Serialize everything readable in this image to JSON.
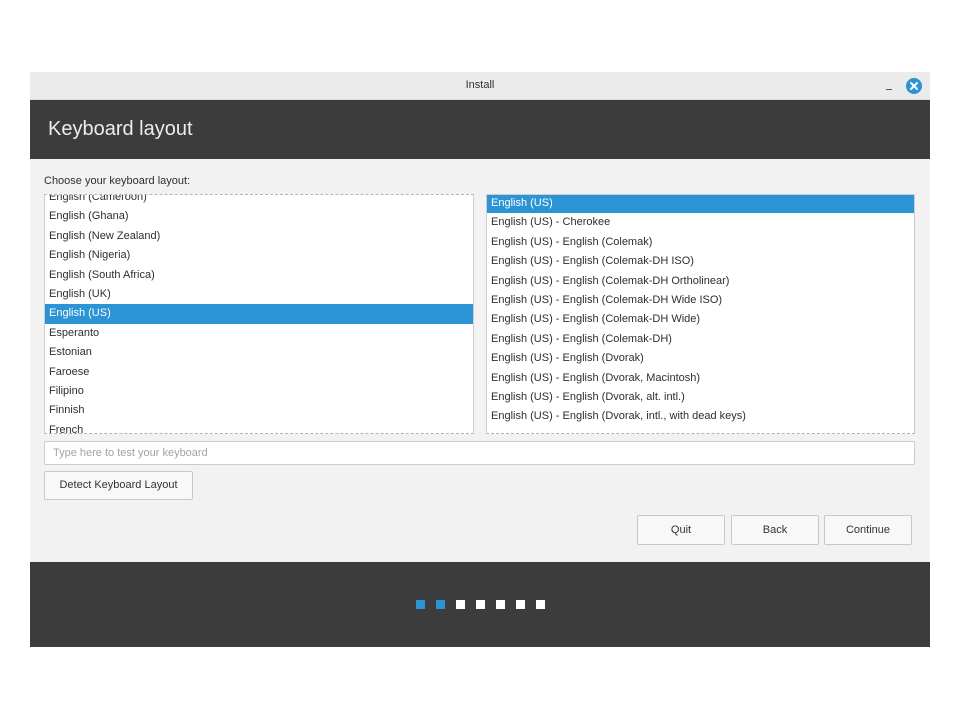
{
  "window": {
    "title": "Install"
  },
  "header": {
    "title": "Keyboard layout"
  },
  "prompt": "Choose your keyboard layout:",
  "layouts": {
    "items": [
      "English (Cameroon)",
      "English (Ghana)",
      "English (New Zealand)",
      "English (Nigeria)",
      "English (South Africa)",
      "English (UK)",
      "English (US)",
      "Esperanto",
      "Estonian",
      "Faroese",
      "Filipino",
      "Finnish",
      "French"
    ],
    "selected_index": 6
  },
  "variants": {
    "items": [
      "English (US)",
      "English (US) - Cherokee",
      "English (US) - English (Colemak)",
      "English (US) - English (Colemak-DH ISO)",
      "English (US) - English (Colemak-DH Ortholinear)",
      "English (US) - English (Colemak-DH Wide ISO)",
      "English (US) - English (Colemak-DH Wide)",
      "English (US) - English (Colemak-DH)",
      "English (US) - English (Dvorak)",
      "English (US) - English (Dvorak, Macintosh)",
      "English (US) - English (Dvorak, alt. intl.)",
      "English (US) - English (Dvorak, intl., with dead keys)"
    ],
    "selected_index": 0
  },
  "test_input": {
    "value": "",
    "placeholder": "Type here to test your keyboard"
  },
  "detect_button": {
    "label": "Detect Keyboard Layout"
  },
  "actions": {
    "quit": "Quit",
    "back": "Back",
    "continue": "Continue"
  },
  "progress": {
    "steps": 7,
    "completed": 2
  },
  "icons": {
    "minimize": "minimize-icon",
    "close": "close-icon"
  },
  "colors": {
    "accent": "#2b94d5",
    "dark_panel": "#3c3c3c",
    "content_bg": "#f2f2f2",
    "selected_text": "#ffffff"
  }
}
